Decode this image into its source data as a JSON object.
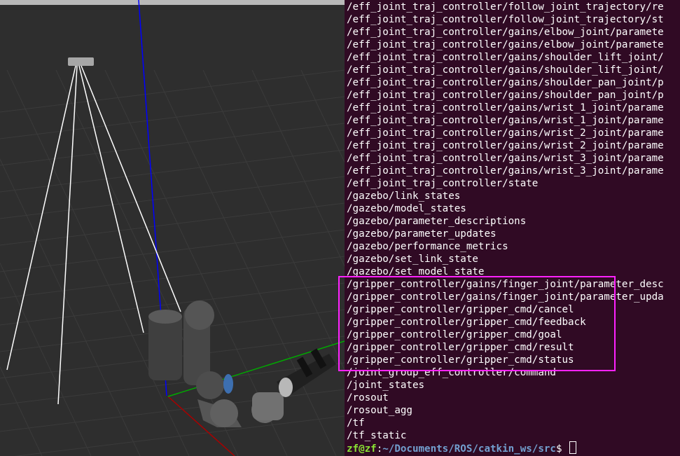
{
  "terminal": {
    "lines": [
      "/eff_joint_traj_controller/follow_joint_trajectory/re",
      "/eff_joint_traj_controller/follow_joint_trajectory/st",
      "/eff_joint_traj_controller/gains/elbow_joint/paramete",
      "/eff_joint_traj_controller/gains/elbow_joint/paramete",
      "/eff_joint_traj_controller/gains/shoulder_lift_joint/",
      "/eff_joint_traj_controller/gains/shoulder_lift_joint/",
      "/eff_joint_traj_controller/gains/shoulder_pan_joint/p",
      "/eff_joint_traj_controller/gains/shoulder_pan_joint/p",
      "/eff_joint_traj_controller/gains/wrist_1_joint/parame",
      "/eff_joint_traj_controller/gains/wrist_1_joint/parame",
      "/eff_joint_traj_controller/gains/wrist_2_joint/parame",
      "/eff_joint_traj_controller/gains/wrist_2_joint/parame",
      "/eff_joint_traj_controller/gains/wrist_3_joint/parame",
      "/eff_joint_traj_controller/gains/wrist_3_joint/parame",
      "/eff_joint_traj_controller/state",
      "/gazebo/link_states",
      "/gazebo/model_states",
      "/gazebo/parameter_descriptions",
      "/gazebo/parameter_updates",
      "/gazebo/performance_metrics",
      "/gazebo/set_link_state",
      "/gazebo/set_model_state",
      "/gripper_controller/gains/finger_joint/parameter_desc",
      "/gripper_controller/gains/finger_joint/parameter_upda",
      "/gripper_controller/gripper_cmd/cancel",
      "/gripper_controller/gripper_cmd/feedback",
      "/gripper_controller/gripper_cmd/goal",
      "/gripper_controller/gripper_cmd/result",
      "/gripper_controller/gripper_cmd/status",
      "/joint_group_eff_controller/command",
      "/joint_states",
      "/rosout",
      "/rosout_agg",
      "/tf",
      "/tf_static"
    ],
    "prompt": {
      "user_host": "zf@zf",
      "separator": ":",
      "path": "~/Documents/ROS/catkin_ws/src",
      "symbol": "$ "
    },
    "highlight_color": "#ff22ff",
    "background_color": "#300a24"
  },
  "scene": {
    "background_color": "#2e2e2e",
    "z_axis_color": "#0000ff",
    "x_axis_color": "#cc0000",
    "y_axis_color": "#00cc00"
  }
}
